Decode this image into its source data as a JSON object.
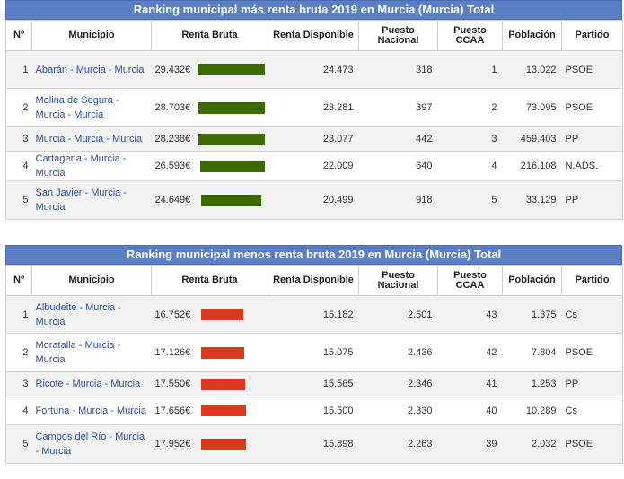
{
  "colors": {
    "header": "#5b7fc4",
    "bar_top": "#3d6a00",
    "bar_bottom": "#d9391f"
  },
  "headers": [
    "Nº",
    "Municipio",
    "Renta Bruta",
    "Renta Disponible",
    "Puesto Nacional",
    "Puesto CCAA",
    "Población",
    "Partido"
  ],
  "tables": [
    {
      "title": "Ranking municipal más renta bruta 2019 en Murcia (Murcia) Total",
      "rows": [
        {
          "n": "1",
          "municipio": "Abarán - Murcia - Murcia",
          "renta_bruta": "29.432€",
          "renta_bruta_value": 29432,
          "renta_disponible": "24.473",
          "puesto_nacional": "318",
          "puesto_ccaa": "1",
          "poblacion": "13.022",
          "partido": "PSOE"
        },
        {
          "n": "2",
          "municipio": "Molina de Segura - Murcia - Murcia",
          "renta_bruta": "28.703€",
          "renta_bruta_value": 28703,
          "renta_disponible": "23.281",
          "puesto_nacional": "397",
          "puesto_ccaa": "2",
          "poblacion": "73.095",
          "partido": "PSOE"
        },
        {
          "n": "3",
          "municipio": "Murcia - Murcia - Murcia",
          "renta_bruta": "28.238€",
          "renta_bruta_value": 28238,
          "renta_disponible": "23.077",
          "puesto_nacional": "442",
          "puesto_ccaa": "3",
          "poblacion": "459.403",
          "partido": "PP"
        },
        {
          "n": "4",
          "municipio": "Cartagena - Murcia - Murcia",
          "renta_bruta": "26.593€",
          "renta_bruta_value": 26593,
          "renta_disponible": "22.009",
          "puesto_nacional": "640",
          "puesto_ccaa": "4",
          "poblacion": "216.108",
          "partido": "N.ADS."
        },
        {
          "n": "5",
          "municipio": "San Javier - Murcia - Murcia",
          "renta_bruta": "24.649€",
          "renta_bruta_value": 24649,
          "renta_disponible": "20.499",
          "puesto_nacional": "918",
          "puesto_ccaa": "5",
          "poblacion": "33.129",
          "partido": "PP"
        }
      ]
    },
    {
      "title": "Ranking municipal menos renta bruta 2019 en Murcia (Murcia) Total",
      "rows": [
        {
          "n": "1",
          "municipio": "Albudeite - Murcia - Murcia",
          "renta_bruta": "16.752€",
          "renta_bruta_value": 16752,
          "renta_disponible": "15.182",
          "puesto_nacional": "2.501",
          "puesto_ccaa": "43",
          "poblacion": "1.375",
          "partido": "Cs"
        },
        {
          "n": "2",
          "municipio": "Moratalla - Murcia - Murcia",
          "renta_bruta": "17.126€",
          "renta_bruta_value": 17126,
          "renta_disponible": "15.075",
          "puesto_nacional": "2.436",
          "puesto_ccaa": "42",
          "poblacion": "7.804",
          "partido": "PSOE"
        },
        {
          "n": "3",
          "municipio": "Ricote - Murcia - Murcia",
          "renta_bruta": "17.550€",
          "renta_bruta_value": 17550,
          "renta_disponible": "15.565",
          "puesto_nacional": "2.346",
          "puesto_ccaa": "41",
          "poblacion": "1.253",
          "partido": "PP"
        },
        {
          "n": "4",
          "municipio": "Fortuna - Murcia - Murcia",
          "renta_bruta": "17.656€",
          "renta_bruta_value": 17656,
          "renta_disponible": "15.500",
          "puesto_nacional": "2.330",
          "puesto_ccaa": "40",
          "poblacion": "10.289",
          "partido": "Cs"
        },
        {
          "n": "5",
          "municipio": "Campos del Río - Murcia - Murcia",
          "renta_bruta": "17.952€",
          "renta_bruta_value": 17952,
          "renta_disponible": "15.898",
          "puesto_nacional": "2.263",
          "puesto_ccaa": "39",
          "poblacion": "2.032",
          "partido": "PSOE"
        }
      ]
    }
  ]
}
